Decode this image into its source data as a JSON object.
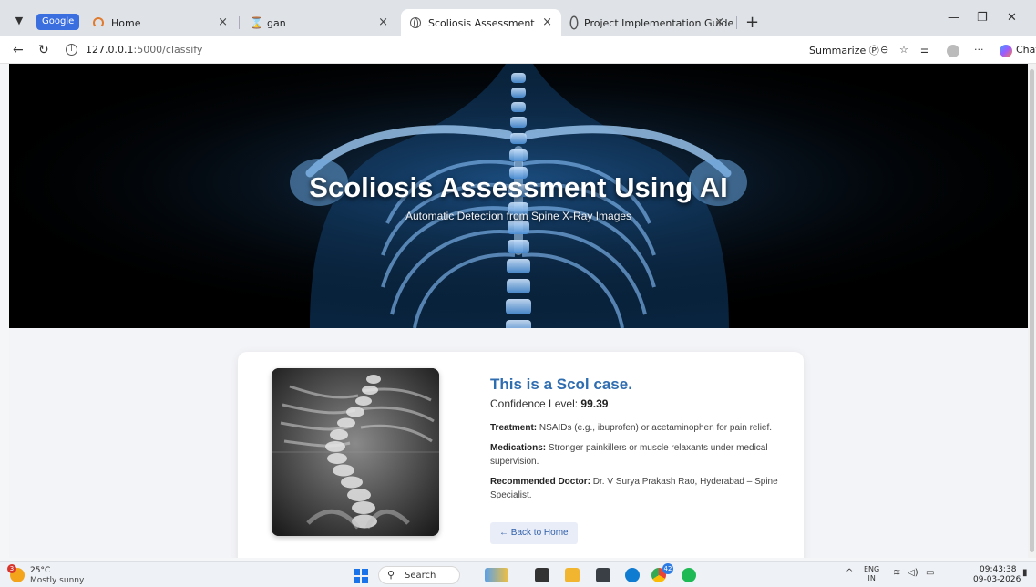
{
  "browser": {
    "group_label": "Google",
    "tabs": [
      {
        "title": "Home",
        "favicon": "home-favicon"
      },
      {
        "title": "gan",
        "favicon": "hourglass-favicon"
      },
      {
        "title": "Scoliosis Assessment",
        "favicon": "globe-favicon",
        "active": true
      },
      {
        "title": "Project Implementation Guide",
        "favicon": "chatgpt-favicon"
      }
    ],
    "url_host": "127.0.0.1",
    "url_path": ":5000/classify",
    "summarize_label": "Summarize",
    "chat_label": "Chat"
  },
  "hero": {
    "title": "Scoliosis Assessment Using AI",
    "subtitle": "Automatic Detection from Spine X-Ray Images"
  },
  "result": {
    "title": "This is a Scol case.",
    "confidence_label": "Confidence Level:",
    "confidence_value": "99.39",
    "treatment_label": "Treatment:",
    "treatment_text": "NSAIDs (e.g., ibuprofen) or acetaminophen for pain relief.",
    "medications_label": "Medications:",
    "medications_text": "Stronger painkillers or muscle relaxants under medical supervision.",
    "doctor_label": "Recommended Doctor:",
    "doctor_text": "Dr. V Surya Prakash Rao, Hyderabad – Spine Specialist.",
    "back_button": "← Back to Home"
  },
  "taskbar": {
    "weather_temp": "25°C",
    "weather_desc": "Mostly sunny",
    "weather_badge": "3",
    "search_label": "Search",
    "app_badge": "42",
    "lang_top": "ENG",
    "lang_bottom": "IN",
    "time": "09:43:38",
    "date": "09-03-2026"
  }
}
